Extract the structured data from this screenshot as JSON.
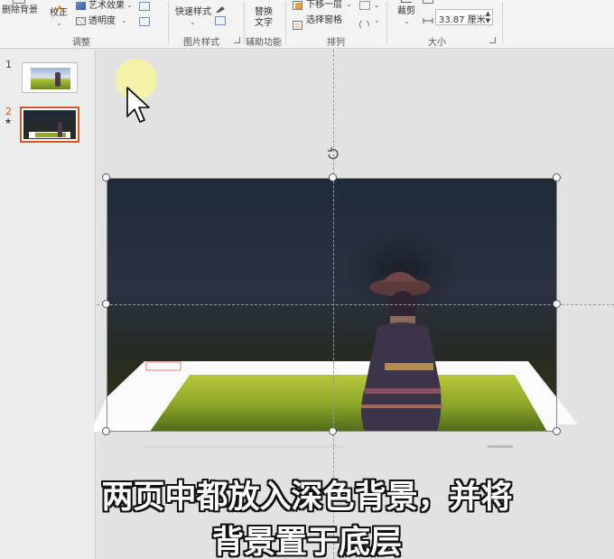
{
  "ribbon": {
    "remove_bg": "删除背景",
    "correct": "校正",
    "art_effect": "艺术效果",
    "transparency": "透明度",
    "group_adjust": "调整",
    "quick_styles": "快速样式",
    "group_picture_styles": "图片样式",
    "alt_text_line1": "替换",
    "alt_text_line2": "文字",
    "group_accessibility": "辅助功能",
    "send_backward": "下移一层",
    "selection_pane": "选择窗格",
    "group_arrange": "排列",
    "crop": "裁剪",
    "width_value": "33.87 厘米",
    "group_size": "大小"
  },
  "slides": [
    {
      "number": "1",
      "star": ""
    },
    {
      "number": "2",
      "star": "★"
    }
  ],
  "subtitle": {
    "line1": "两页中都放入深色背景，并将",
    "line2": "背景置于底层"
  },
  "colors": {
    "accent": "#d9541e",
    "dark_bg_top": "#1f2a38",
    "dark_bg_bottom": "#2a2a1a",
    "grass": "#8fa82a"
  },
  "icons": [
    "remove-background-icon",
    "correct-icon",
    "art-effects-icon",
    "transparency-icon",
    "quick-styles-icon",
    "alt-text-icon",
    "send-backward-icon",
    "selection-pane-icon",
    "crop-icon",
    "width-icon",
    "rotate-icon",
    "cursor-icon"
  ]
}
